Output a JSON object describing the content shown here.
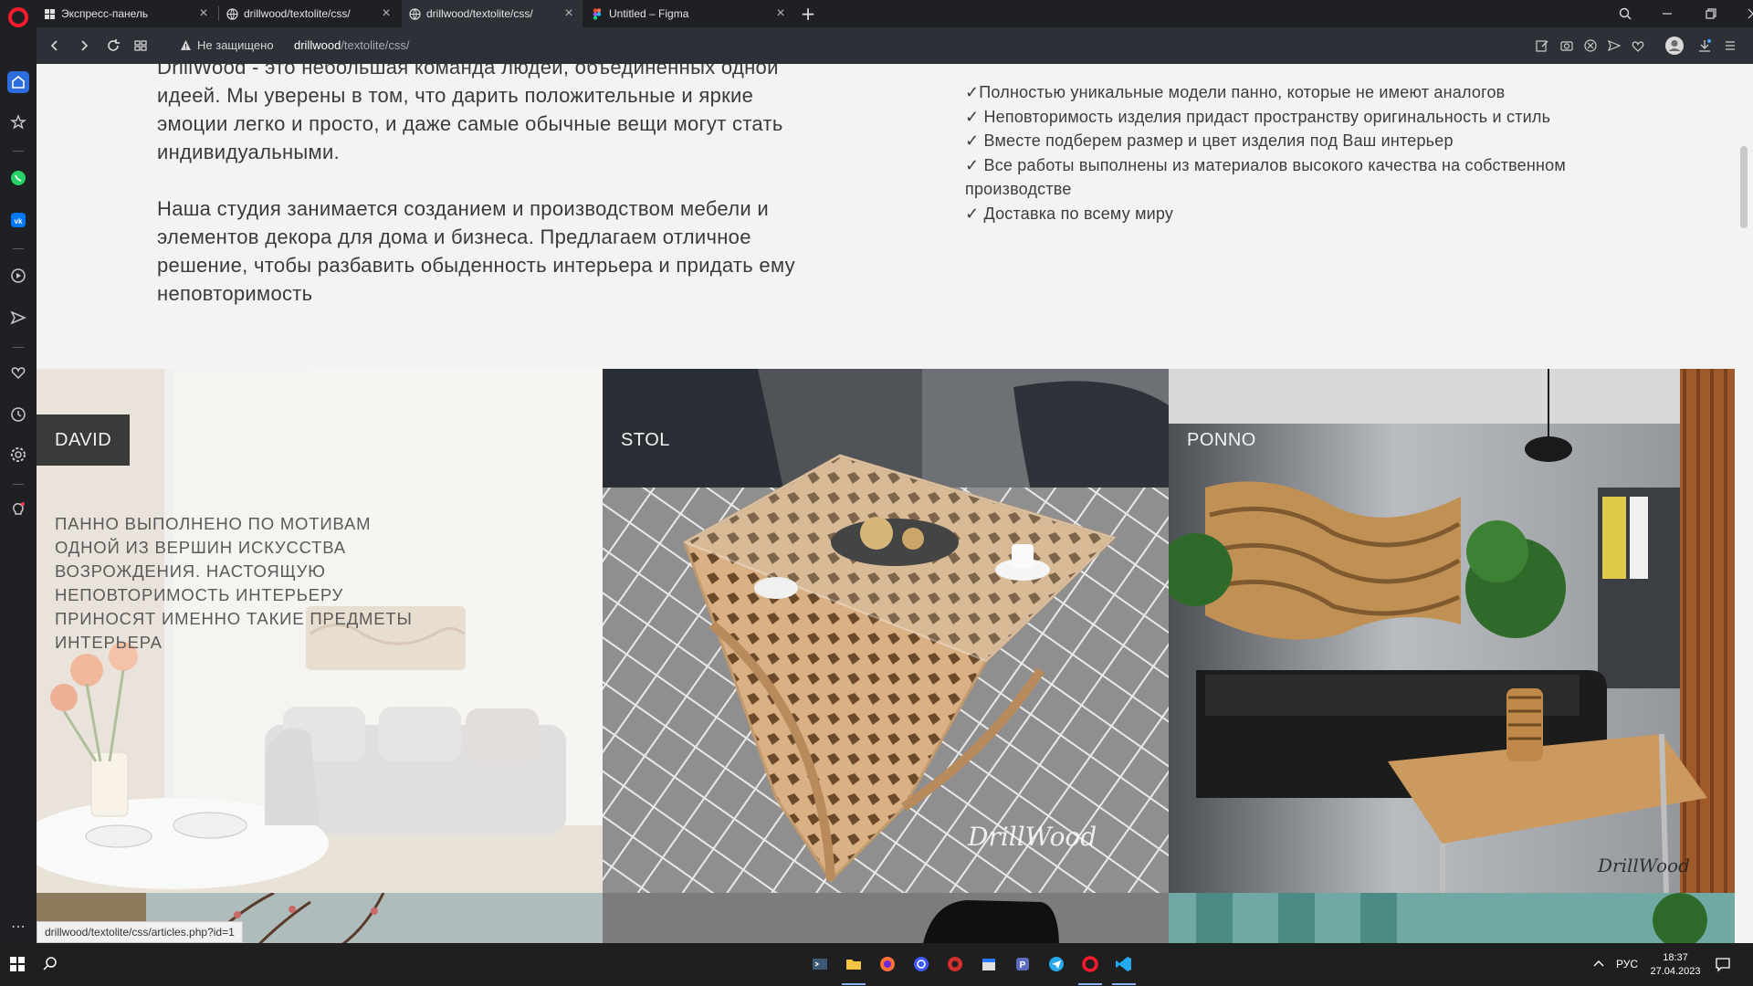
{
  "browser": {
    "tabs": [
      {
        "title": "Экспресс-панель",
        "icon": "grid-icon",
        "active": false
      },
      {
        "title": "drillwood/textolite/css/",
        "icon": "globe-icon",
        "active": false
      },
      {
        "title": "drillwood/textolite/css/",
        "icon": "globe-icon",
        "active": true
      },
      {
        "title": "Untitled – Figma",
        "icon": "figma-icon",
        "active": false
      }
    ],
    "security_label": "Не защищено",
    "url_host": "drillwood",
    "url_path": "/textolite/css/",
    "status_url": "drillwood/textolite/css/articles.php?id=1"
  },
  "page": {
    "intro_left": [
      "DrillWood - это небольшая команда людей, объединенных одной идеей. Мы уверены в том, что дарить положительные и яркие эмоции легко и просто, и даже самые обычные вещи могут стать индивидуальными.",
      "Наша студия занимается созданием и производством мебели и элементов декора для дома и бизнеса. Предлагаем отличное решение, чтобы разбавить обыденность интерьера и придать ему неповторимость"
    ],
    "features": [
      "✓Полностью уникальные модели панно, которые не имеют аналогов",
      "✓ Неповторимость изделия придаст пространству оригинальность и стиль",
      "✓ Вместе подберем размер и цвет изделия под Ваш интерьер",
      "✓ Все работы выполнены из материалов высокого качества на собственном производстве",
      "✓ Доставка по всему миру"
    ],
    "cards": [
      {
        "label": "DAVID",
        "description": "ПАННО ВЫПОЛНЕНО ПО МОТИВАМ ОДНОЙ ИЗ ВЕРШИН ИСКУССТВА ВОЗРОЖДЕНИЯ. НАСТОЯЩУЮ НЕПОВТОРИМОСТЬ ИНТЕРЬЕРУ ПРИНОСЯТ ИМЕННО ТАКИЕ ПРЕДМЕТЫ ИНТЕРЬЕРА"
      },
      {
        "label": "STOL",
        "signature": "DrillWood"
      },
      {
        "label": "PONNO",
        "signature": "DrillWood"
      }
    ]
  },
  "taskbar": {
    "language": "РУС",
    "time": "18:37",
    "date": "27.04.2023"
  },
  "colors": {
    "opera_red": "#ff1b2d",
    "page_bg": "#f3f3f3",
    "label_bg": "#3a3a3a"
  }
}
